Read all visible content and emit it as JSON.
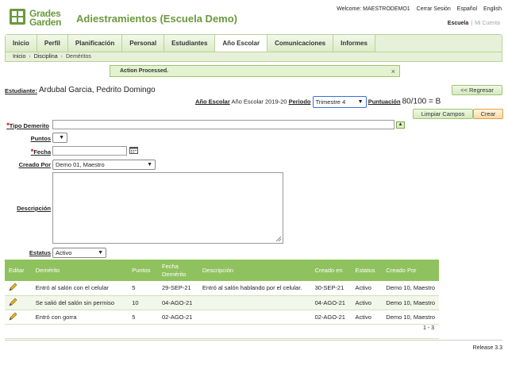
{
  "app": {
    "logo_line1": "Grades",
    "logo_line2": "Garden",
    "title": "Adiestramientos (Escuela Demo)"
  },
  "topnav": {
    "welcome": "Welcome: MAESTRODEMO1",
    "logout": "Cerrar Sesión",
    "lang_es": "Español",
    "lang_en": "English"
  },
  "subnav": {
    "school": "Escuela",
    "account": "Mi Cuenta"
  },
  "tabs": [
    {
      "label": "Inicio"
    },
    {
      "label": "Perfil"
    },
    {
      "label": "Planificación"
    },
    {
      "label": "Personal"
    },
    {
      "label": "Estudiantes"
    },
    {
      "label": "Año Escolar"
    },
    {
      "label": "Comunicaciones"
    },
    {
      "label": "Informes"
    }
  ],
  "active_tab": "Año Escolar",
  "breadcrumb": [
    "Inicio",
    "Disciplina",
    "Deméritos"
  ],
  "message": {
    "text": "Action Processed.",
    "close": "×"
  },
  "student": {
    "label": "Estudiante:",
    "name": "Ardubal Garcia, Pedrito Domingo"
  },
  "buttons": {
    "back": "<< Regresar",
    "clear": "Limpiar Campos",
    "create": "Crear"
  },
  "year_row": {
    "year_label": "Año Escolar",
    "year_value": "Año Escolar 2019-20",
    "period_label": "Periodo",
    "period_value": "Trimestre 4",
    "score_label": "Puntuación",
    "score_value": "80/100 = B"
  },
  "form": {
    "tipo_label": "Tipo Demerito",
    "tipo_value": "",
    "puntos_label": "Puntos",
    "puntos_value": "",
    "fecha_label": "Fecha",
    "fecha_value": "",
    "creado_label": "Creado Por",
    "creado_value": "Demo 01, Maestro",
    "desc_label": "Descripción",
    "desc_value": "",
    "estatus_label": "Estatus",
    "estatus_value": "Activo"
  },
  "table": {
    "headers": [
      "Editar",
      "Demérito",
      "Puntos",
      "Fecha Demérito",
      "Descripción",
      "Creado en",
      "Estatus",
      "Creado Por"
    ],
    "rows": [
      {
        "demerito": "Entró al salón con el celular",
        "puntos": "5",
        "fecha": "29-SEP-21",
        "descripcion": "Entró al salón hablando por el celular.",
        "creado_en": "30-SEP-21",
        "estatus": "Activo",
        "creado_por": "Demo 10, Maestro"
      },
      {
        "demerito": "Se salió del salón sin permiso",
        "puntos": "10",
        "fecha": "04-AGO-21",
        "descripcion": "",
        "creado_en": "04-AGO-21",
        "estatus": "Activo",
        "creado_por": "Demo 10, Maestro"
      },
      {
        "demerito": "Entró con gorra",
        "puntos": "5",
        "fecha": "02-AGO-21",
        "descripcion": "",
        "creado_en": "02-AGO-21",
        "estatus": "Activo",
        "creado_por": "Demo 10, Maestro"
      }
    ],
    "pager": "1 - 3"
  },
  "release": "Release 3.3",
  "icons": {
    "edit": "pencil-icon",
    "calendar": "calendar-icon",
    "add": "add-icon"
  },
  "colors": {
    "brand": "#6a9a3c",
    "table_header": "#8fc25e",
    "tab_bg": "#e7f1d9"
  }
}
